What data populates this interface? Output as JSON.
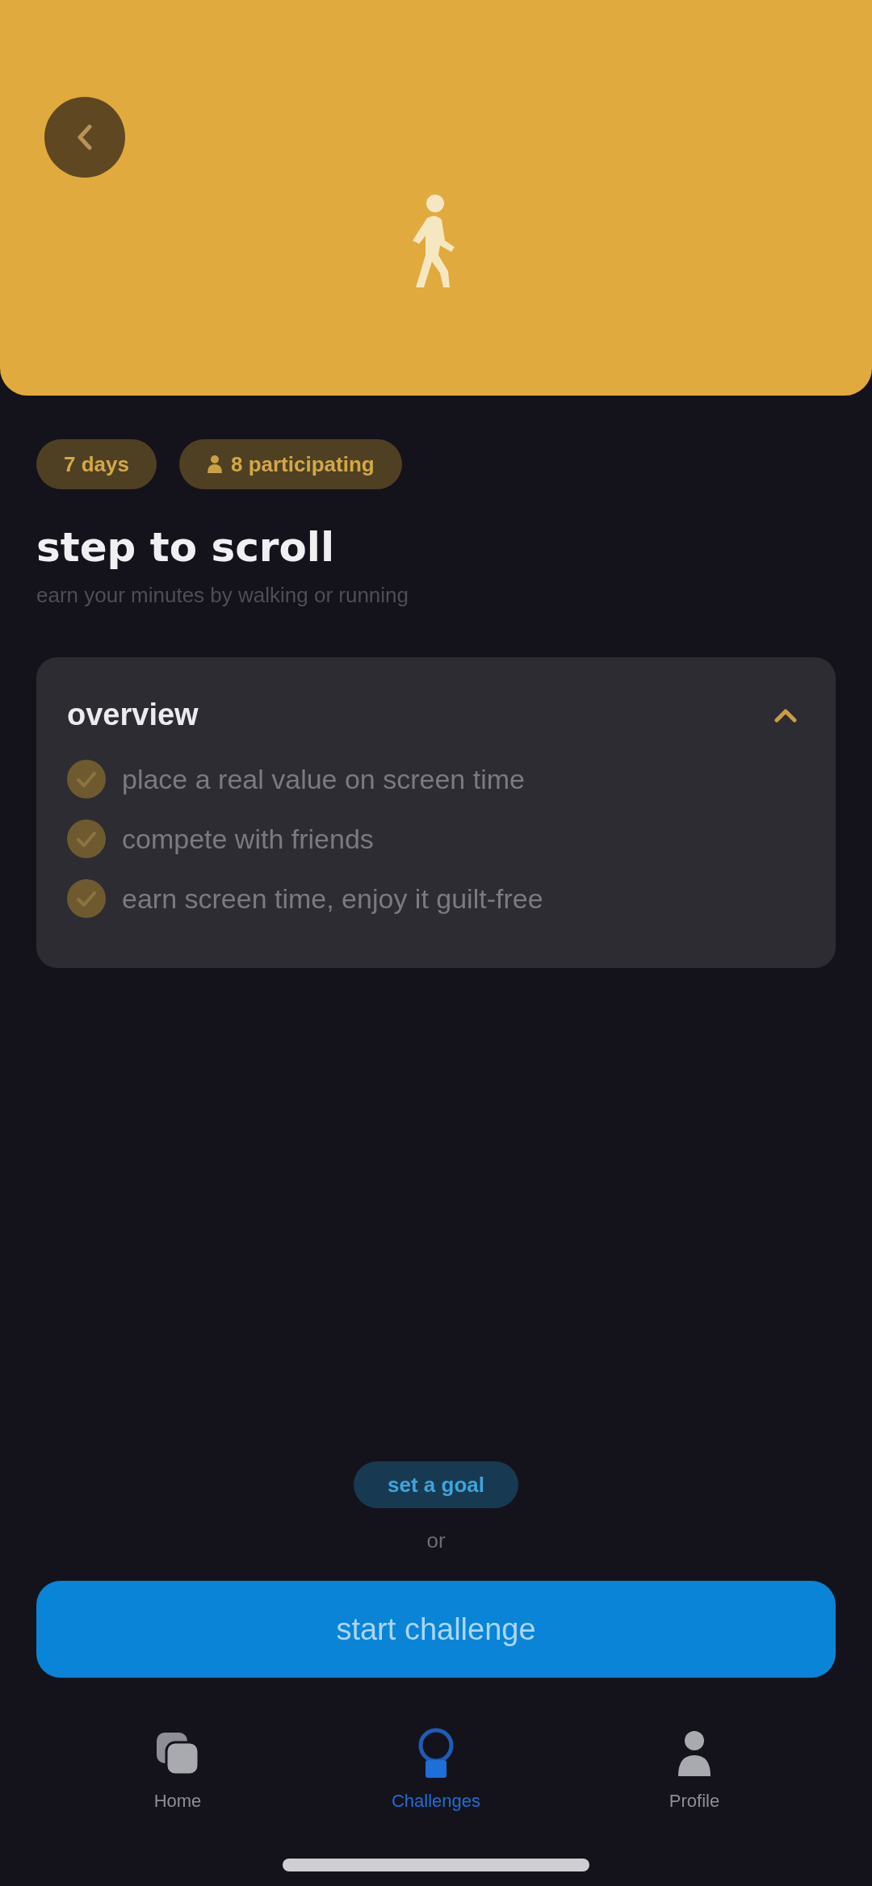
{
  "tags": [
    {
      "label": "7 days",
      "kind": "plain"
    },
    {
      "label": "8 participating",
      "kind": "people"
    }
  ],
  "title": "step to scroll",
  "subtitle": "earn your minutes by walking or running",
  "overview": {
    "title": "overview",
    "expanded": true,
    "items": [
      "place a real value on screen time",
      "compete with friends",
      "earn screen time, enjoy it guilt-free"
    ]
  },
  "secondary_button": "set a goal",
  "separator": "or",
  "primary_button": "start challenge",
  "tab_bar": [
    {
      "label": "Home",
      "kind": "home",
      "selected": false
    },
    {
      "label": "Challenges",
      "kind": "challenges",
      "selected": true
    },
    {
      "label": "Profile",
      "kind": "profile",
      "selected": false
    }
  ]
}
